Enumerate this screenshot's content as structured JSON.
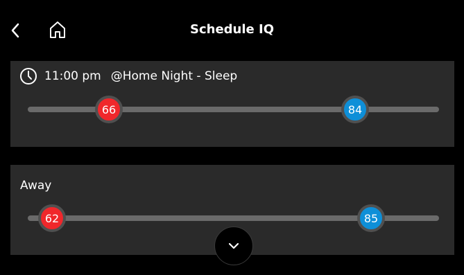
{
  "header": {
    "title": "Schedule IQ",
    "back_icon": "chevron-left-icon",
    "home_icon": "home-icon"
  },
  "schedule": [
    {
      "time": "11:00 pm",
      "name": "@Home Night - Sleep",
      "heat_setpoint": "66",
      "cool_setpoint": "84"
    },
    {
      "name": "Away",
      "heat_setpoint": "62",
      "cool_setpoint": "85"
    }
  ],
  "colors": {
    "heat": "#f0272b",
    "cool": "#0e8fd8",
    "card_bg": "#2a2a2a",
    "track": "#6a6a6a"
  },
  "expand_icon": "chevron-down-icon"
}
